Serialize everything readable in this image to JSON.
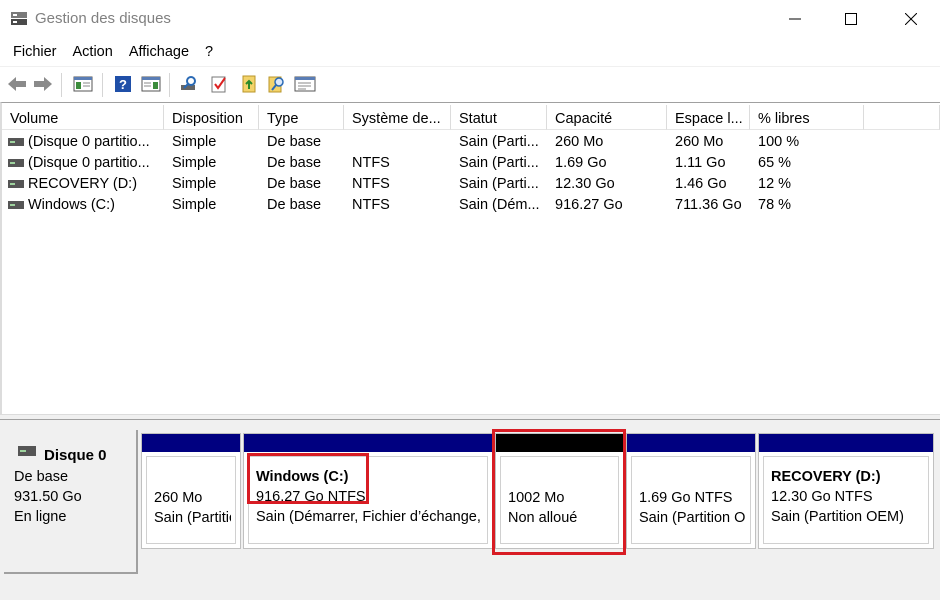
{
  "window": {
    "title": "Gestion des disques"
  },
  "menu": [
    "Fichier",
    "Action",
    "Affichage",
    "?"
  ],
  "toolbar": {
    "icons": [
      "back-arrow-icon",
      "forward-arrow-icon",
      "console-tree-icon",
      "help-icon",
      "action-pane-icon",
      "rescan-icon",
      "check-icon",
      "import-icon",
      "search-icon",
      "properties-icon"
    ]
  },
  "table": {
    "columns": [
      "Volume",
      "Disposition",
      "Type",
      "Système de...",
      "Statut",
      "Capacité",
      "Espace l...",
      "% libres"
    ],
    "rows": [
      [
        "(Disque 0 partitio...",
        "Simple",
        "De base",
        "",
        "Sain (Parti...",
        "260 Mo",
        "260 Mo",
        "100 %"
      ],
      [
        "(Disque 0 partitio...",
        "Simple",
        "De base",
        "NTFS",
        "Sain (Parti...",
        "1.69 Go",
        "1.11 Go",
        "65 %"
      ],
      [
        "RECOVERY (D:)",
        "Simple",
        "De base",
        "NTFS",
        "Sain (Parti...",
        "12.30 Go",
        "1.46 Go",
        "12 %"
      ],
      [
        "Windows (C:)",
        "Simple",
        "De base",
        "NTFS",
        "Sain (Dém...",
        "916.27 Go",
        "711.36 Go",
        "78 %"
      ]
    ]
  },
  "disk": {
    "name": "Disque 0",
    "type": "De base",
    "size": "931.50 Go",
    "status": "En ligne",
    "partitions": [
      {
        "title": "",
        "line1": "260 Mo",
        "line2": "Sain (Partition",
        "unallocated": false
      },
      {
        "title": "Windows  (C:)",
        "line1": "916.27 Go NTFS",
        "line2": "Sain (Démarrer, Fichier d’échange,",
        "unallocated": false
      },
      {
        "title": "",
        "line1": "1002 Mo",
        "line2": "Non alloué",
        "unallocated": true
      },
      {
        "title": "",
        "line1": "1.69 Go NTFS",
        "line2": "Sain (Partition OE",
        "unallocated": false
      },
      {
        "title": "RECOVERY  (D:)",
        "line1": "12.30 Go NTFS",
        "line2": "Sain (Partition OEM)",
        "unallocated": false
      }
    ]
  },
  "colors": {
    "partition_bar": "#000080",
    "unallocated_bar": "#000000",
    "highlight": "#d81c24"
  }
}
